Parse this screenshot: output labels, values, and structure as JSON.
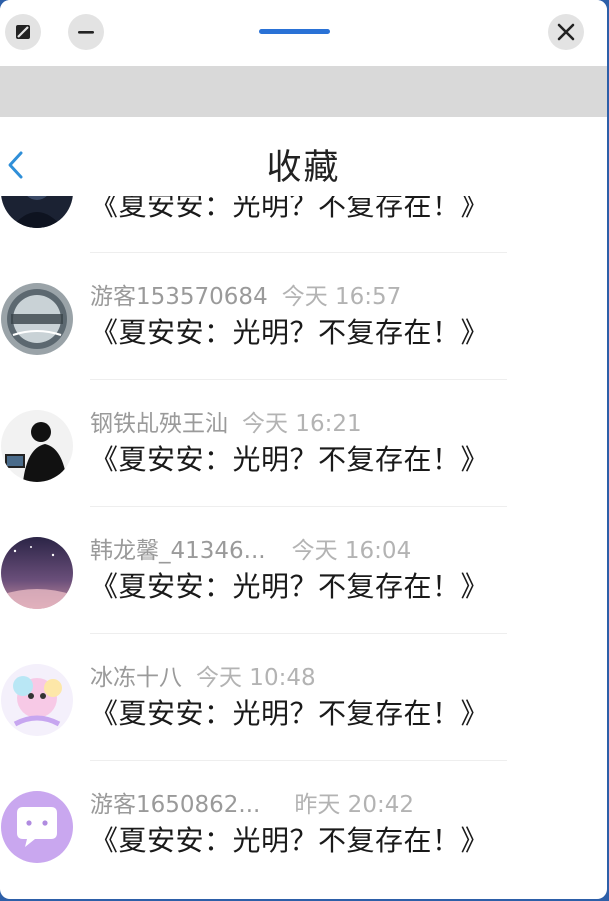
{
  "titlebar": {
    "restore_icon": "restore-icon",
    "minimize_icon": "minimize-icon",
    "close_icon": "close-icon",
    "accent": "#2a72d6"
  },
  "nav": {
    "back_icon": "chevron-left-icon",
    "title": "收藏",
    "back_color": "#2f8fd8"
  },
  "items": [
    {
      "user": "",
      "time": "",
      "message": "《夏安安：光明？不复存在！》",
      "avatar": "dark-portrait-avatar"
    },
    {
      "user": "游客153570684",
      "time": "今天 16:57",
      "message": "《夏安安：光明？不复存在！》",
      "avatar": "globe-logo-avatar"
    },
    {
      "user": "钢铁乩殃王汕",
      "time": "今天 16:21",
      "message": "《夏安安：光明？不复存在！》",
      "avatar": "silhouette-avatar"
    },
    {
      "user": "韩龙馨_41346...",
      "time": "今天 16:04",
      "message": "《夏安安：光明？不复存在！》",
      "avatar": "night-sky-avatar"
    },
    {
      "user": "冰冻十八",
      "time": "今天 10:48",
      "message": "《夏安安：光明？不复存在！》",
      "avatar": "pastel-character-avatar"
    },
    {
      "user": "游客1650862...",
      "time": "昨天 20:42",
      "message": "《夏安安：光明？不复存在！》",
      "avatar": "chat-bubble-avatar"
    }
  ]
}
